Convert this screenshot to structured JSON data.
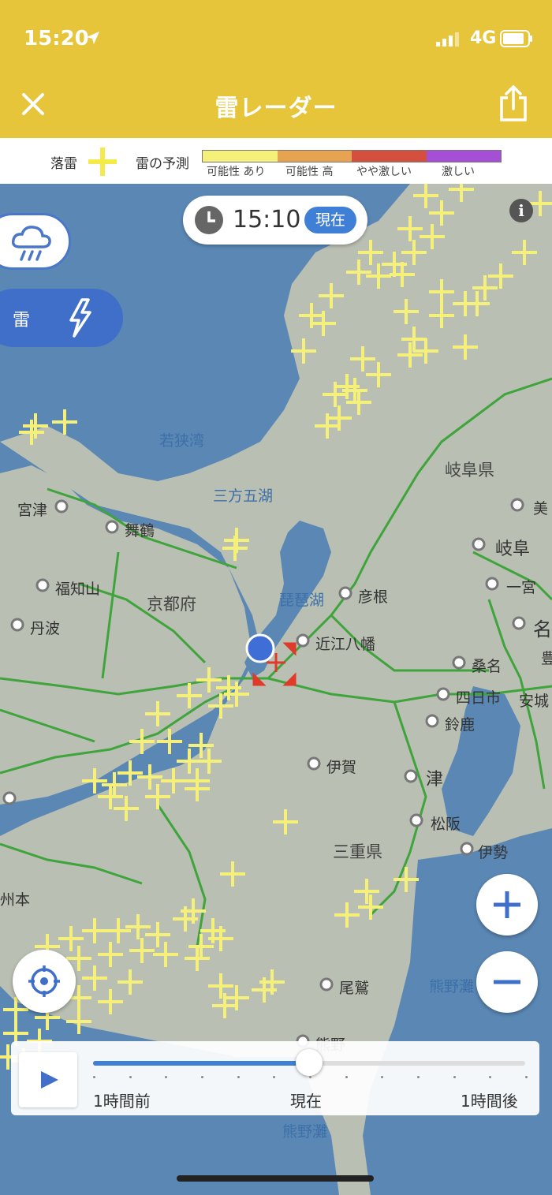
{
  "status_bar": {
    "time": "15:20",
    "network": "4G"
  },
  "header": {
    "title": "雷レーダー"
  },
  "legend": {
    "lightning_label": "落雷",
    "forecast_label": "雷の予測",
    "levels": [
      "可能性 あり",
      "可能性 高",
      "やや激しい",
      "激しい"
    ],
    "colors": {
      "possible": "#f4f07a",
      "high": "#e6a452",
      "somewhat_intense": "#d44f3e",
      "intense": "#a54fd6"
    }
  },
  "time_pill": {
    "time": "15:10",
    "now_label": "現在"
  },
  "layer_buttons": {
    "thunder_label": "雷"
  },
  "timeline": {
    "start_label": "1時間前",
    "current_label": "現在",
    "end_label": "1時間後",
    "position": 0.5
  },
  "map": {
    "prefectures": [
      "京都府",
      "岐阜県",
      "三重県"
    ],
    "water": [
      "若狭湾",
      "三方五湖",
      "琵琶湖",
      "熊野灘",
      "熊野灘"
    ],
    "places": [
      "宮津",
      "舞鶴",
      "福知山",
      "丹波",
      "彦根",
      "近江八幡",
      "岐阜",
      "美",
      "一宮",
      "名",
      "桑名",
      "四日市",
      "安城",
      "鈴鹿",
      "伊賀",
      "津",
      "松阪",
      "伊勢",
      "尾鷲",
      "熊野",
      "州本",
      "豊"
    ]
  }
}
